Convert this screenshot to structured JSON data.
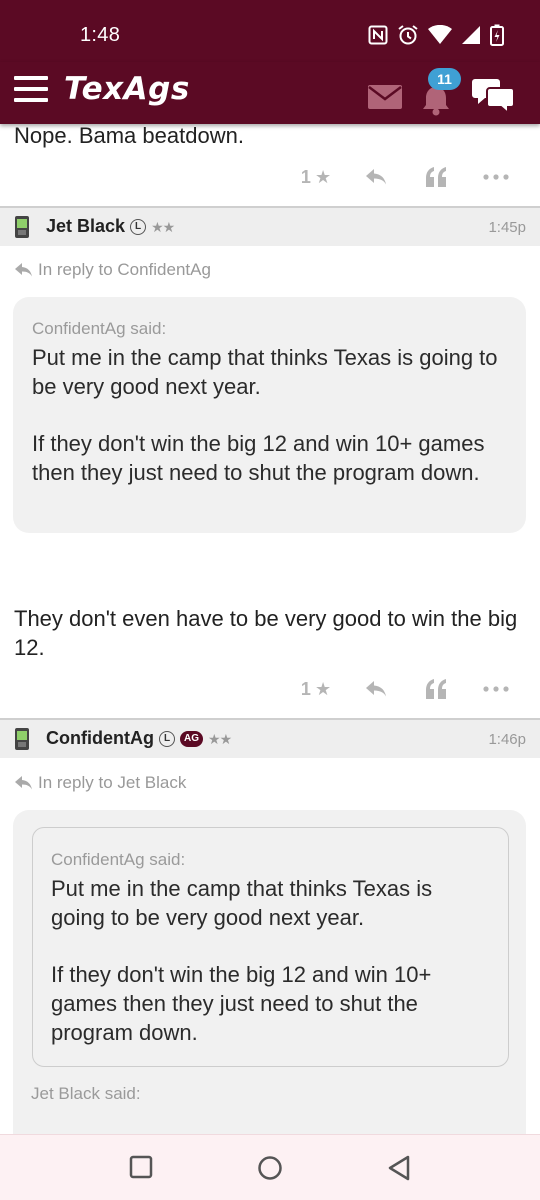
{
  "status_bar": {
    "time": "1:48"
  },
  "app_bar": {
    "logo": "TexAgs",
    "notification_count": "11"
  },
  "posts": [
    {
      "body": "Nope. Bama beatdown.",
      "star_count": "1"
    },
    {
      "author": "Jet Black",
      "badge_l": "L",
      "stars": "★★",
      "time": "1:45p",
      "reply_to": "In reply to ConfidentAg",
      "quote_author": "ConfidentAg said:",
      "quote_p1": "Put me in the camp that thinks Texas is going to be very good next year.",
      "quote_p2": "If they don't win the big 12 and win 10+ games then they just need to shut the program down.",
      "body": "They don't even have to be very good to win the big 12.",
      "star_count": "1"
    },
    {
      "author": "ConfidentAg",
      "badge_l": "L",
      "badge_ag": "AG",
      "stars": "★★",
      "time": "1:46p",
      "reply_to": "In reply to Jet Black",
      "inner_quote_author": "ConfidentAg said:",
      "inner_quote_p1": "Put me in the camp that thinks Texas is going to be very good next year.",
      "inner_quote_p2": "If they don't win the big 12 and win 10+ games then they just need to shut the program down.",
      "outer_quote_author": "Jet Black said:"
    }
  ],
  "colors": {
    "brand": "#5b0a24",
    "accent": "#3fa0d4"
  }
}
